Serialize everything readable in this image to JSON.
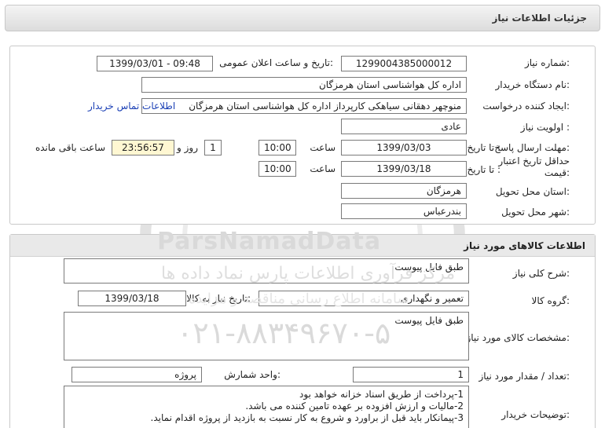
{
  "header": {
    "title": "جزئیات اطلاعات نیاز"
  },
  "need_info": {
    "need_number_label": "شماره نیاز:",
    "need_number": "1299004385000012",
    "announce_label": "تاریخ و ساعت اعلان عمومی:",
    "announce_value": "1399/03/01 - 09:48",
    "buyer_org_label": "نام دستگاه خریدار:",
    "buyer_org": "اداره کل هواشناسی استان هرمزگان",
    "creator_label": "ایجاد کننده درخواست:",
    "creator": "منوچهر دهقانی سیاهکی کارپرداز اداره کل هواشناسی استان هرمزگان",
    "contact_link": "اطلاعات تماس خریدار",
    "priority_label": "اولویت نیاز :",
    "priority": "عادی",
    "deadline_label": "مهلت ارسال پاسخ:",
    "until_label": "تا تاریخ :",
    "deadline_date": "1399/03/03",
    "time_label": "ساعت",
    "deadline_time": "10:00",
    "days_value": "1",
    "days_label": "روز و",
    "remaining_time": "23:56:57",
    "remaining_label": "ساعت باقی مانده",
    "validity_label": "حداقل تاریخ اعتبار قیمت:",
    "validity_until_label": "تا تاریخ :",
    "validity_date": "1399/03/18",
    "validity_time_label": "ساعت",
    "validity_time": "10:00",
    "province_label": "استان محل تحویل:",
    "province": "هرمزگان",
    "city_label": "شهر محل تحویل:",
    "city": "بندرعباس"
  },
  "goods": {
    "section_title": "اطلاعات کالاهای مورد نیاز",
    "summary_label": "شرح کلی نیاز:",
    "summary": "طبق فایل پیوست",
    "group_label": "گروه کالا:",
    "group": "تعمیر و نگهداری",
    "need_date_label": "تاریخ نیاز به کالا:",
    "need_date": "1399/03/18",
    "specs_label": "مشخصات کالای مورد نیاز:",
    "specs": "طبق فایل پیوست",
    "qty_label": "تعداد / مقدار مورد نیاز:",
    "qty": "1",
    "unit_label": "واحد شمارش:",
    "unit": "پروژه",
    "notes_label": "توضیحات خریدار:",
    "notes": [
      "1-پرداخت از طریق اسناد خزانه خواهد بود",
      "2-مالیات و ارزش افزوده بر عهده تامین کننده می باشد.",
      "3-پیمانکار باید قبل از براورد و شروع به کار نسبت به بازدید از پروژه اقدام نماید."
    ]
  },
  "watermark": {
    "brand": "ParsNamadData",
    "line1": "مرکز فرآوری اطلاعات پارس نماد داده ها",
    "line2": "سامانه اطلاع رسانی مناقصه و مزایده",
    "phone": "۰۲۱-۸۸۳۴۹۶۷۰-۵"
  }
}
